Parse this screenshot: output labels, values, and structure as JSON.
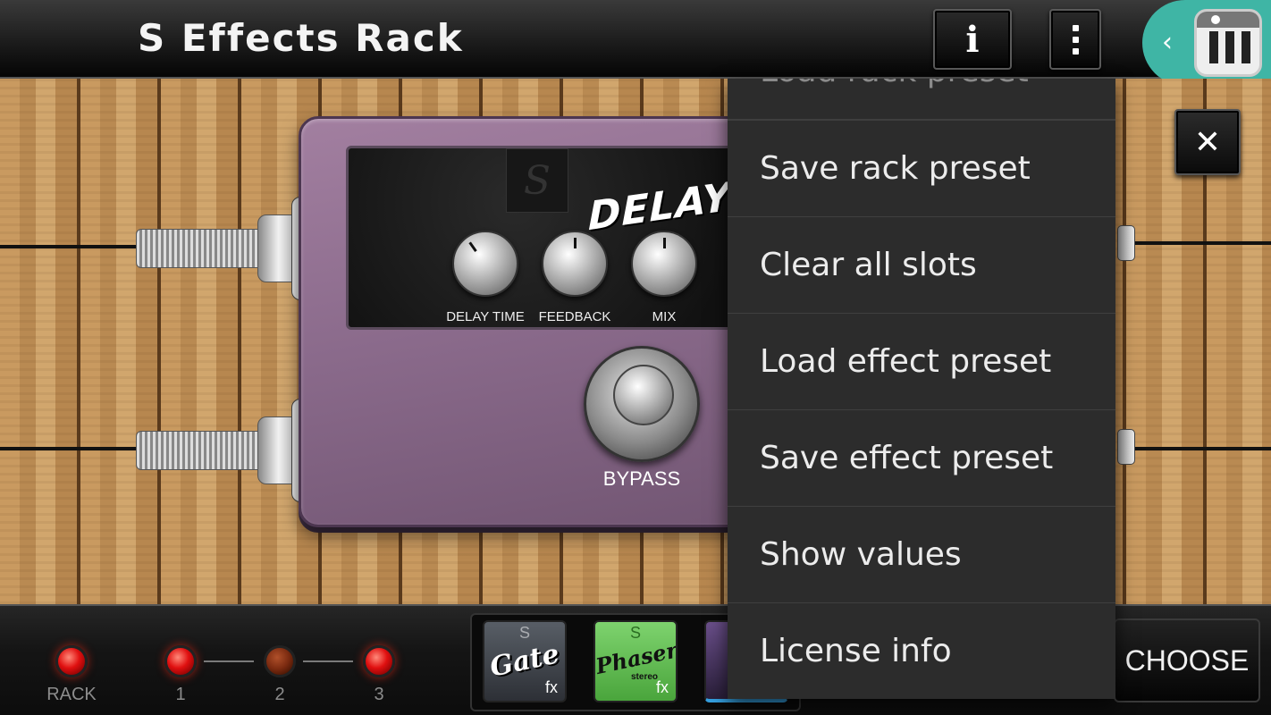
{
  "header": {
    "title": "S Effects Rack",
    "info_label": "i"
  },
  "launcher": {
    "icon": "piano-app-icon"
  },
  "pedal": {
    "logo": "S",
    "name": "DELAY",
    "knobs": [
      "DELAY TIME",
      "FEEDBACK",
      "MIX"
    ],
    "bypass_label": "BYPASS"
  },
  "close_label": "✕",
  "menu": {
    "items": [
      "Load rack preset",
      "Save rack preset",
      "Clear all slots",
      "Load effect preset",
      "Save effect preset",
      "Show values",
      "License info"
    ]
  },
  "bottom": {
    "leds": [
      {
        "label": "RACK",
        "on": true
      },
      {
        "label": "1",
        "on": true
      },
      {
        "label": "2",
        "on": false
      },
      {
        "label": "3",
        "on": true
      }
    ],
    "slots": [
      {
        "badge": "S",
        "name": "Gate",
        "sub": "",
        "fx": "fx"
      },
      {
        "badge": "S",
        "name": "Phaser",
        "sub": "stereo",
        "fx": "fx"
      }
    ],
    "choose_label": "CHOOSE"
  }
}
